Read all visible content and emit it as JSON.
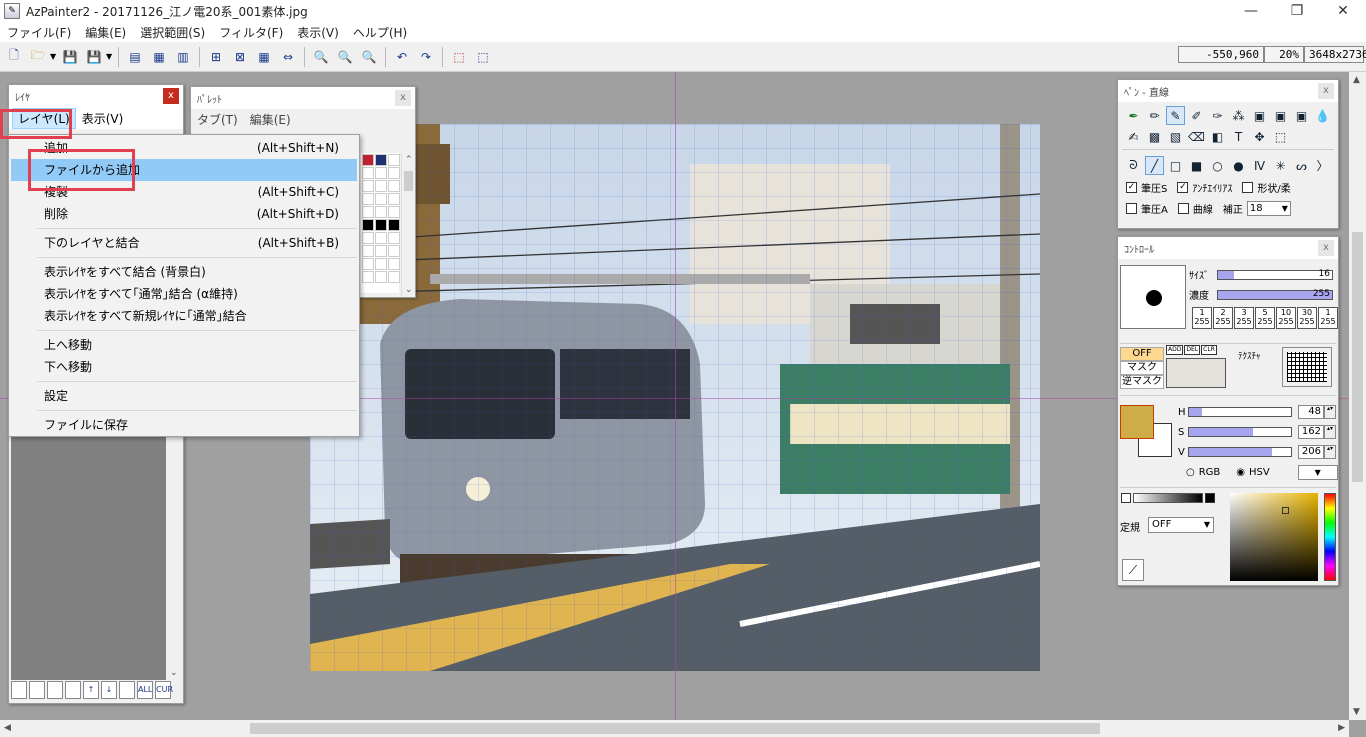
{
  "window": {
    "title": "AzPainter2 - 20171126_江ノ電20系_001素体.jpg",
    "app_icon": "azpainter-icon",
    "minimize": "—",
    "maximize": "❐",
    "close": "✕"
  },
  "menubar": [
    "ファイル(F)",
    "編集(E)",
    "選択範囲(S)",
    "フィルタ(F)",
    "表示(V)",
    "ヘルプ(H)"
  ],
  "status": {
    "coords": "-550,960",
    "zoom": "20%",
    "size": "3648x2736"
  },
  "layer_panel": {
    "title": "ﾚｲﾔ",
    "close": "x",
    "menu_layer": "レイヤ(L)",
    "menu_view": "表示(V)",
    "bottom_buttons": [
      "",
      "",
      "",
      "",
      "↑",
      "↓",
      "",
      "ALL",
      "CUR"
    ]
  },
  "palette_panel": {
    "title": "ﾊﾟﾚｯﾄ",
    "close": "x",
    "menu_tab": "タブ(T)",
    "menu_edit": "編集(E)"
  },
  "context_menu": [
    {
      "label": "追加",
      "accel": "(Alt+Shift+N)"
    },
    {
      "label": "ファイルから追加",
      "accel": ""
    },
    {
      "label": "複製",
      "accel": "(Alt+Shift+C)"
    },
    {
      "label": "削除",
      "accel": "(Alt+Shift+D)"
    },
    {
      "label": "下のレイヤと結合",
      "accel": "(Alt+Shift+B)"
    },
    {
      "label": "表示ﾚｲﾔをすべて結合 (背景白)",
      "accel": ""
    },
    {
      "label": "表示ﾚｲﾔをすべて｢通常｣結合 (α維持)",
      "accel": ""
    },
    {
      "label": "表示ﾚｲﾔをすべて新規ﾚｲﾔに｢通常｣結合",
      "accel": ""
    },
    {
      "label": "上へ移動",
      "accel": ""
    },
    {
      "label": "下へ移動",
      "accel": ""
    },
    {
      "label": "設定",
      "accel": ""
    },
    {
      "label": "ファイルに保存",
      "accel": ""
    }
  ],
  "pen_panel": {
    "title": "ﾍﾟﾝ - 直線",
    "close": "x",
    "options": {
      "pressure_s": "筆圧S",
      "antialias": "ｱﾝﾁｴｲﾘｱｽ",
      "shape": "形状/柔",
      "pressure_a": "筆圧A",
      "curve": "曲線",
      "correction": "補正",
      "correction_value": "18"
    }
  },
  "control_panel": {
    "title": "ｺﾝﾄﾛｰﾙ",
    "close": "x",
    "size_label": "ｻｲｽﾞ",
    "size_value": "16",
    "density_label": "濃度",
    "density_value": "255",
    "presets": [
      [
        "1",
        "255"
      ],
      [
        "2",
        "255"
      ],
      [
        "3",
        "255"
      ],
      [
        "5",
        "255"
      ],
      [
        "10",
        "255"
      ],
      [
        "30",
        "255"
      ],
      [
        "1",
        "255"
      ]
    ],
    "mask_off": "OFF",
    "mask": "マスク",
    "inv_mask": "逆マスク",
    "mask_btns": [
      "ADD",
      "DEL",
      "CLR"
    ],
    "texture": "ﾃｸｽﾁｬ",
    "h_label": "H",
    "h_value": "48",
    "s_label": "S",
    "s_value": "162",
    "v_label": "V",
    "v_value": "206",
    "rgb": "RGB",
    "hsv": "HSV",
    "ruler_label": "定規",
    "ruler_value": "OFF",
    "colors": {
      "foreground": "#ceac48",
      "background": "#ffffff"
    }
  }
}
